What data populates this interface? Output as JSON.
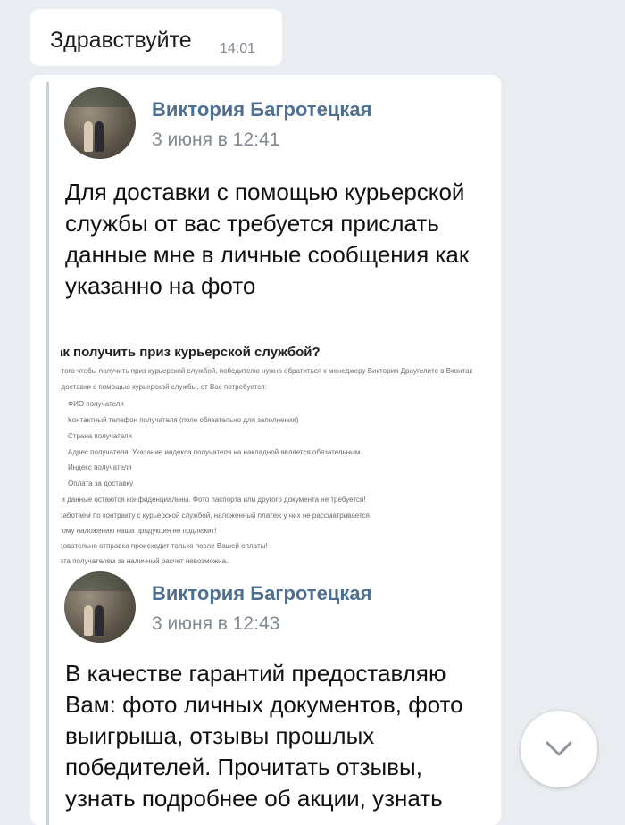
{
  "greeting": {
    "text": "Здравствуйте",
    "time": "14:01"
  },
  "posts": [
    {
      "author": "Виктория Багротецкая",
      "date": "3 июня в 12:41",
      "message": "Для доставки с помощью курьерской службы от вас требуется прислать данные мне в личные сообщения как указанно на фото"
    },
    {
      "author": "Виктория Багротецкая",
      "date": "3 июня в 12:43",
      "message": "В качестве гарантий предоставляю Вам: фото личных документов, фото выигрыша, отзывы прошлых победителей. Прочитать отзывы, узнать подробнее об акции, узнать"
    }
  ],
  "attached_image": {
    "title": "ак получить приз курьерской службой?",
    "intro": [
      "я того чтобы получить приз курьерской службой, победителю нужно обратиться к менеджеру Виктории Драугелите в Вконтак",
      "я доставки с помощью курьерской службы, от Вас потребуется:"
    ],
    "items": [
      "ФИО получателя",
      "Контактный телефон получателя (поле обязательно для заполнения)",
      "Страна получателя",
      "Адрес получателя. Указание индекса получателя на накладной является обязательным.",
      "Индекс получателя",
      "Оплата за доставку"
    ],
    "notes": [
      "ши данные остаются конфиденциальны. Фото паспорта или другого документа не требуется!",
      "і работаем по контракту с курьерской службой, наложенный платеж у них не рассматривается.",
      "этому наложению наша продукция не подлежит!",
      "эдовательно отправка происходит только после Вашей оплаты!",
      "лата получателем за наличный расчет невозможна."
    ]
  },
  "icons": {
    "scroll_down": "chevron-down-icon"
  },
  "colors": {
    "author": "#4f6f92",
    "background": "#e9ecf0",
    "bubble": "#ffffff"
  }
}
